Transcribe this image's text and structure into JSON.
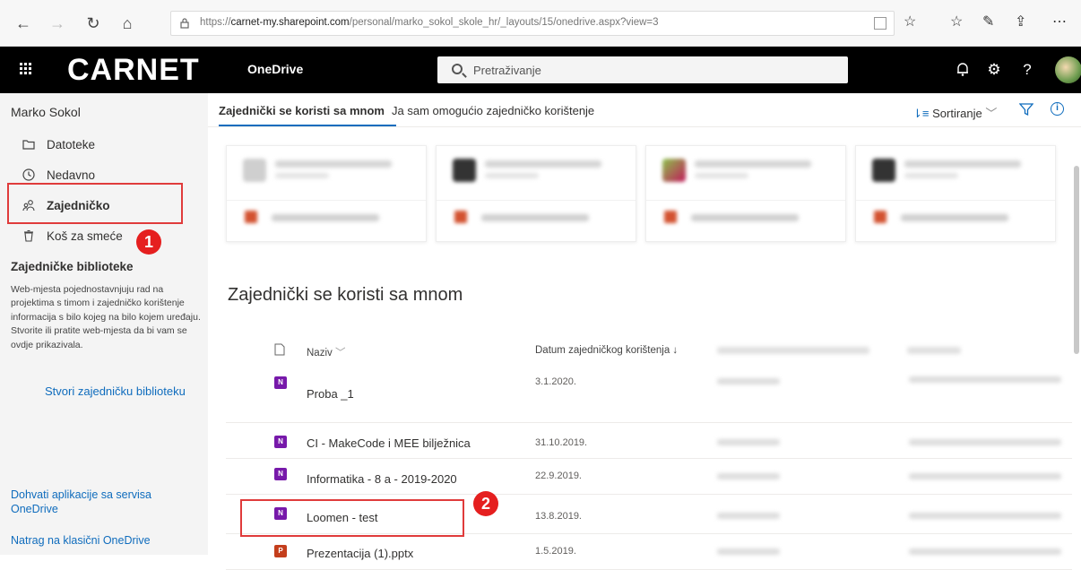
{
  "browser": {
    "url_prefix": "https://",
    "url_host": "carnet-my.sharepoint.com",
    "url_path": "/personal/marko_sokol_skole_hr/_layouts/15/onedrive.aspx?view=3"
  },
  "suite": {
    "logo": "CARNET",
    "app_name": "OneDrive",
    "search_placeholder": "Pretraživanje",
    "help_label": "?"
  },
  "sidebar": {
    "user": "Marko Sokol",
    "items": [
      {
        "label": "Datoteke",
        "icon": "folder-icon"
      },
      {
        "label": "Nedavno",
        "icon": "clock-icon"
      },
      {
        "label": "Zajedničko",
        "icon": "share-icon"
      },
      {
        "label": "Koš za smeće",
        "icon": "trash-icon"
      }
    ],
    "section_title": "Zajedničke biblioteke",
    "section_desc": "Web-mjesta pojednostavnjuju rad na projektima s timom i zajedničko korištenje informacija s bilo kojeg na bilo kojem uređaju. Stvorite ili pratite web-mjesta da bi vam se ovdje prikazivala.",
    "create_link": "Stvori zajedničku biblioteku",
    "get_apps": "Dohvati aplikacije sa servisa OneDrive",
    "classic": "Natrag na klasični OneDrive"
  },
  "tabs": [
    "Zajednički se koristi sa mnom",
    "Ja sam omogućio zajedničko korištenje"
  ],
  "toolbar": {
    "sort_label": "Sortiranje"
  },
  "annotations": {
    "marker_1": "1",
    "marker_2": "2"
  },
  "list": {
    "title": "Zajednički se koristi sa mnom",
    "col_name": "Naziv",
    "col_date": "Datum zajedničkog korištenja",
    "rows": [
      {
        "name": "Proba _1",
        "date": "3.1.2020.",
        "type": "onenote"
      },
      {
        "name": "CI - MakeCode i MEE bilježnica",
        "date": "31.10.2019.",
        "type": "onenote"
      },
      {
        "name": "Informatika - 8 a - 2019-2020",
        "date": "22.9.2019.",
        "type": "onenote"
      },
      {
        "name": "Loomen - test",
        "date": "13.8.2019.",
        "type": "onenote"
      },
      {
        "name": "Prezentacija (1).pptx",
        "date": "1.5.2019.",
        "type": "pptx"
      }
    ]
  },
  "colors": {
    "accent": "#0f6cbd",
    "marker_red": "#e51f1f",
    "onenote": "#7719aa",
    "powerpoint": "#c43e1c"
  }
}
